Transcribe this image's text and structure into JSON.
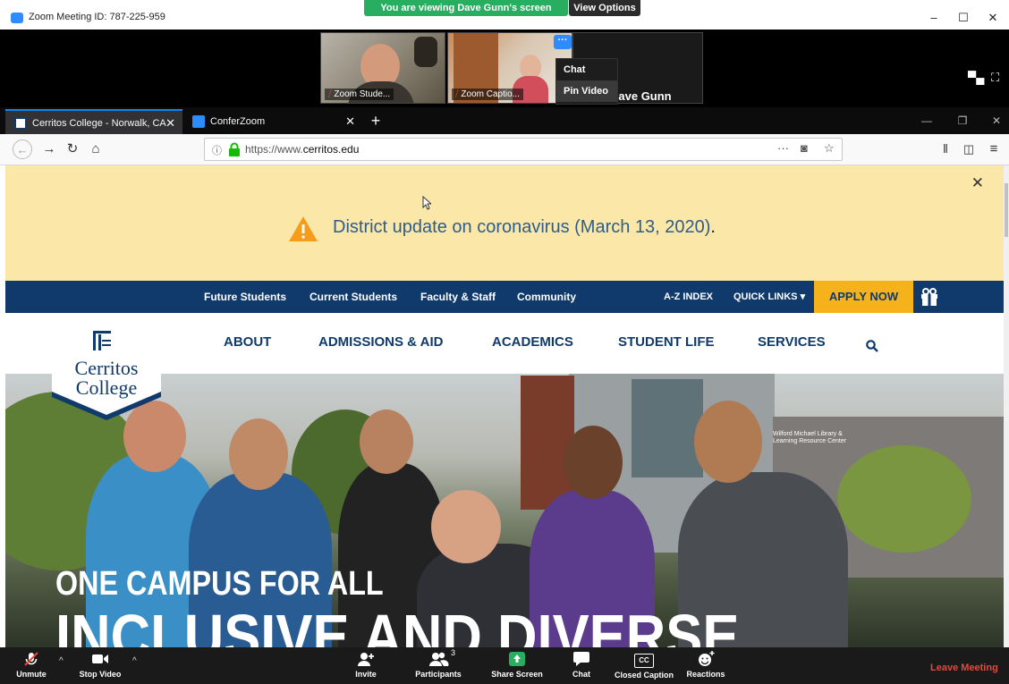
{
  "zoom_window": {
    "title": "Zoom Meeting ID: 787-225-959",
    "viewing_banner": "You are viewing Dave Gunn's screen",
    "view_options_label": "View Options",
    "window_buttons": [
      "–",
      "☐",
      "✕"
    ]
  },
  "video_strip": {
    "participants": [
      {
        "label": "Zoom Stude..."
      },
      {
        "label": "Zoom Captio..."
      }
    ],
    "speaker_name": "Dave Gunn",
    "more_button": "···",
    "context_menu": [
      "Chat",
      "Pin Video"
    ]
  },
  "browser": {
    "tabs": [
      {
        "title": "Cerritos College - Norwalk, CA",
        "active": true
      },
      {
        "title": "ConferZoom",
        "active": false
      }
    ],
    "url_prefix": "https://www.",
    "url_domain": "cerritos.edu",
    "url_suffix": "",
    "nav_icons": [
      "back-arrow",
      "forward-arrow",
      "reload",
      "home"
    ],
    "url_action_icons": [
      "···",
      "pocket",
      "☆"
    ],
    "toolbar_icons": [
      "library",
      "sidebar",
      "menu"
    ]
  },
  "alert": {
    "text": "District update on coronavirus (March 13, 2020)",
    "trailing": "."
  },
  "utility_nav": {
    "items": [
      "Future Students",
      "Current Students",
      "Faculty & Staff",
      "Community"
    ],
    "az_index": "A-Z INDEX",
    "quick_links": "QUICK LINKS",
    "apply_now": "APPLY NOW"
  },
  "main_nav": {
    "items": [
      "ABOUT",
      "ADMISSIONS & AID",
      "ACADEMICS",
      "STUDENT LIFE",
      "SERVICES"
    ]
  },
  "logo": {
    "line1": "Cerritos",
    "line2": "College"
  },
  "hero": {
    "line1": "ONE CAMPUS FOR ALL",
    "line2": "INCLUSIVE AND DIVERSE",
    "building_sign_1": "Wilford Michael Library &",
    "building_sign_2": "Learning Resource Center"
  },
  "zoom_toolbar": {
    "unmute": "Unmute",
    "stop_video": "Stop Video",
    "invite": "Invite",
    "participants": "Participants",
    "participants_count": "3",
    "share_screen": "Share Screen",
    "chat": "Chat",
    "closed_caption": "Closed Caption",
    "cc_glyph": "CC",
    "reactions": "Reactions",
    "leave": "Leave Meeting"
  },
  "colors": {
    "zoom_blue": "#2d8cff",
    "share_green": "#27ae60",
    "cerritos_navy": "#0f3a6b",
    "apply_gold": "#f5b21a",
    "alert_bg": "#fbe8a9",
    "leave_red": "#e8453c"
  }
}
